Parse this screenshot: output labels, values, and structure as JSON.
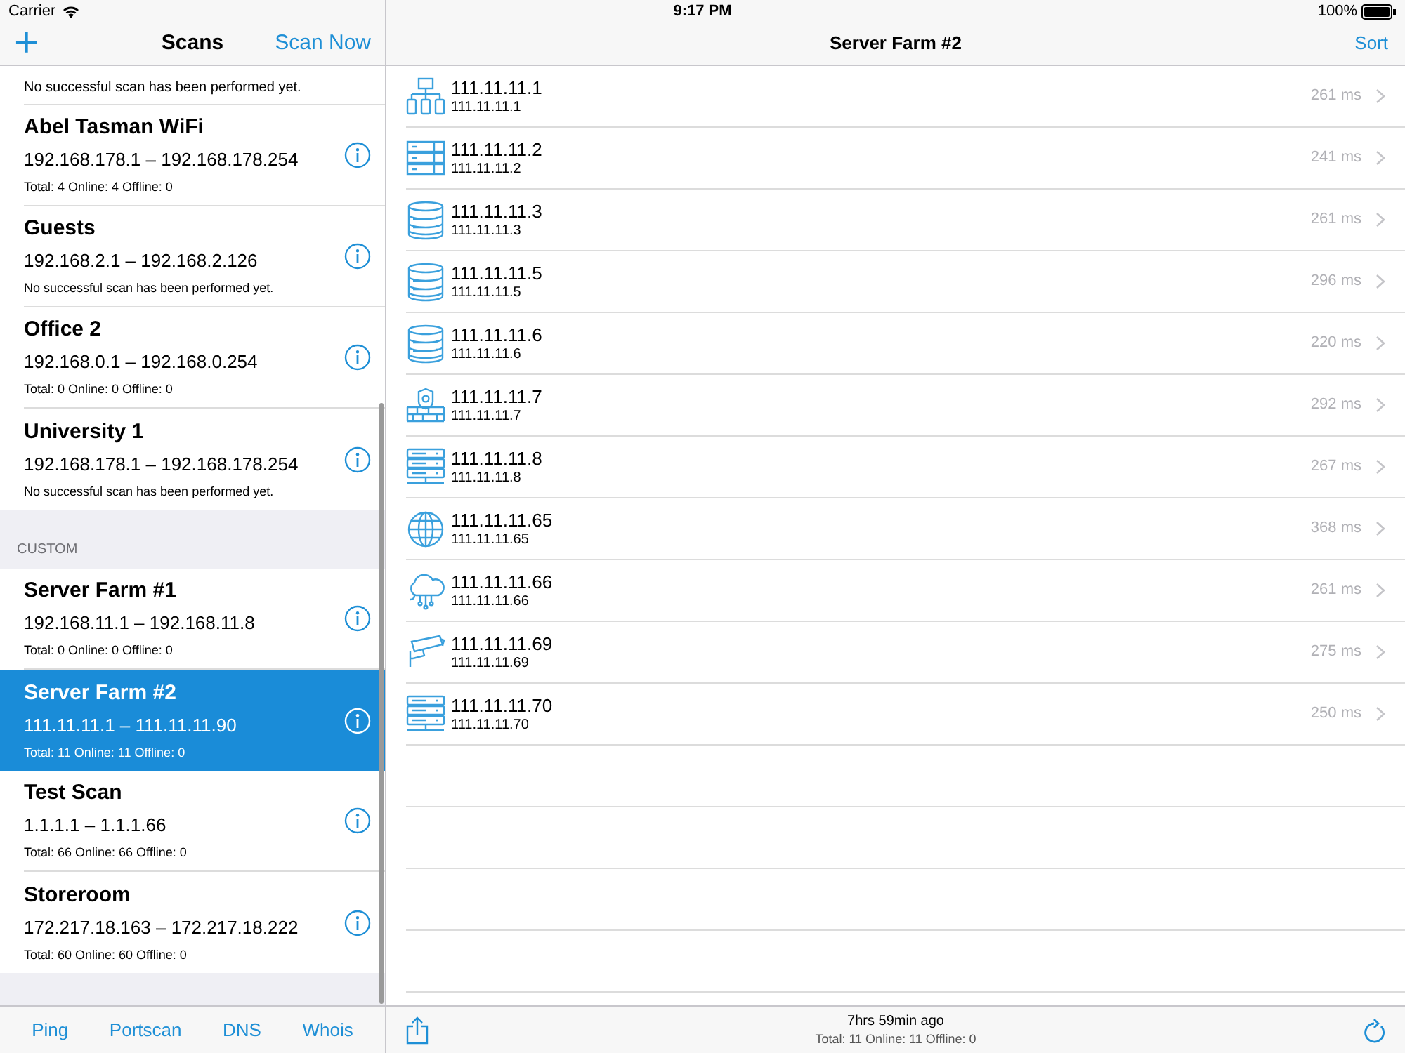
{
  "status_bar": {
    "carrier": "Carrier",
    "time": "9:17 PM",
    "battery": "100%"
  },
  "sidebar": {
    "title": "Scans",
    "add_button": "+",
    "action": "Scan Now",
    "partial_row": {
      "summary": "No successful scan has been performed yet."
    },
    "groups": [
      {
        "scans": [
          {
            "name": "Abel Tasman WiFi",
            "range": "192.168.178.1 – 192.168.178.254",
            "summary": "Total: 4 Online: 4 Offline: 0",
            "selected": false
          },
          {
            "name": "Guests",
            "range": "192.168.2.1 – 192.168.2.126",
            "summary": "No successful scan has been performed yet.",
            "selected": false
          },
          {
            "name": "Office 2",
            "range": "192.168.0.1 – 192.168.0.254",
            "summary": "Total: 0 Online: 0 Offline: 0",
            "selected": false
          },
          {
            "name": "University 1",
            "range": "192.168.178.1 – 192.168.178.254",
            "summary": "No successful scan has been performed yet.",
            "selected": false
          }
        ]
      },
      {
        "header": "CUSTOM",
        "scans": [
          {
            "name": "Server Farm #1",
            "range": "192.168.11.1 – 192.168.11.8",
            "summary": "Total: 0 Online: 0 Offline: 0",
            "selected": false
          },
          {
            "name": "Server Farm #2",
            "range": "111.11.11.1 – 111.11.11.90",
            "summary": "Total: 11 Online: 11 Offline: 0",
            "selected": true
          },
          {
            "name": "Test Scan",
            "range": "1.1.1.1 – 1.1.1.66",
            "summary": "Total: 66 Online: 66 Offline: 0",
            "selected": false
          },
          {
            "name": "Storeroom",
            "range": "172.217.18.163 – 172.217.18.222",
            "summary": "Total: 60 Online: 60 Offline: 0",
            "selected": false
          }
        ]
      }
    ],
    "toolbar": [
      "Ping",
      "Portscan",
      "DNS",
      "Whois"
    ]
  },
  "detail": {
    "title": "Server Farm #2",
    "action": "Sort",
    "devices": [
      {
        "kind": "network",
        "name": "111.11.11.1",
        "address": "111.11.11.1",
        "latency": "261 ms"
      },
      {
        "kind": "rack",
        "name": "111.11.11.2",
        "address": "111.11.11.2",
        "latency": "241 ms"
      },
      {
        "kind": "database",
        "name": "111.11.11.3",
        "address": "111.11.11.3",
        "latency": "261 ms"
      },
      {
        "kind": "database",
        "name": "111.11.11.5",
        "address": "111.11.11.5",
        "latency": "296 ms"
      },
      {
        "kind": "database",
        "name": "111.11.11.6",
        "address": "111.11.11.6",
        "latency": "220 ms"
      },
      {
        "kind": "firewall",
        "name": "111.11.11.7",
        "address": "111.11.11.7",
        "latency": "292 ms"
      },
      {
        "kind": "server",
        "name": "111.11.11.8",
        "address": "111.11.11.8",
        "latency": "267 ms"
      },
      {
        "kind": "globe",
        "name": "111.11.11.65",
        "address": "111.11.11.65",
        "latency": "368 ms"
      },
      {
        "kind": "cloud",
        "name": "111.11.11.66",
        "address": "111.11.11.66",
        "latency": "261 ms"
      },
      {
        "kind": "camera",
        "name": "111.11.11.69",
        "address": "111.11.11.69",
        "latency": "275 ms"
      },
      {
        "kind": "server",
        "name": "111.11.11.70",
        "address": "111.11.11.70",
        "latency": "250 ms"
      }
    ],
    "footer": {
      "time": "7hrs 59min ago",
      "summary": "Total: 11 Online: 11 Offline: 0"
    }
  }
}
